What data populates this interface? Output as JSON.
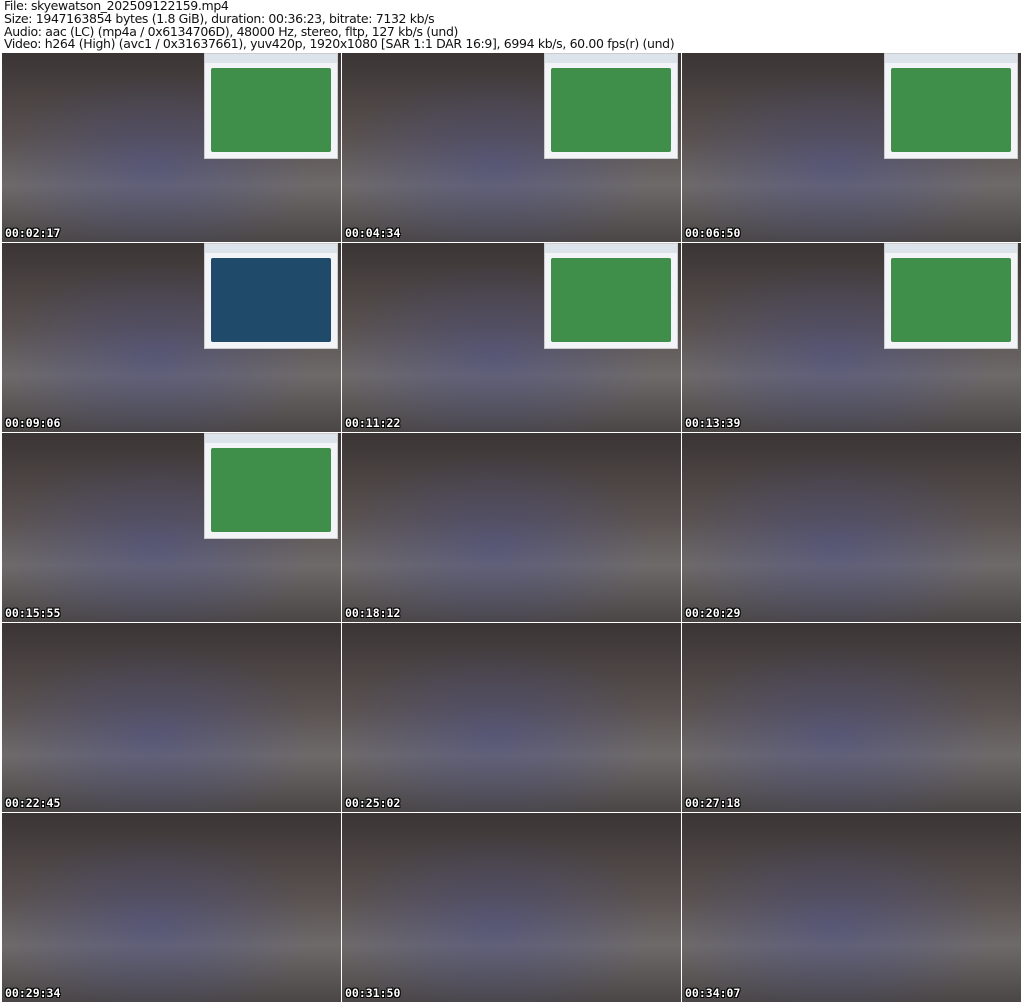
{
  "header": {
    "file": "File: skyewatson_202509122159.mp4",
    "size": "Size: 1947163854 bytes (1.8 GiB), duration: 00:36:23, bitrate: 7132 kb/s",
    "audio": "Audio: aac (LC) (mp4a / 0x6134706D), 48000 Hz, stereo, fltp, 127 kb/s (und)",
    "video": "Video: h264 (High) (avc1 / 0x31637661), yuv420p, 1920x1080 [SAR 1:1 DAR 16:9], 6994 kb/s, 60.00 fps(r) (und)"
  },
  "thumbnails": [
    {
      "time": "00:02:17",
      "overlay": "map"
    },
    {
      "time": "00:04:34",
      "overlay": "map"
    },
    {
      "time": "00:06:50",
      "overlay": "map"
    },
    {
      "time": "00:09:06",
      "overlay": "dark"
    },
    {
      "time": "00:11:22",
      "overlay": "map"
    },
    {
      "time": "00:13:39",
      "overlay": "map"
    },
    {
      "time": "00:15:55",
      "overlay": "map"
    },
    {
      "time": "00:18:12",
      "overlay": ""
    },
    {
      "time": "00:20:29",
      "overlay": ""
    },
    {
      "time": "00:22:45",
      "overlay": ""
    },
    {
      "time": "00:25:02",
      "overlay": ""
    },
    {
      "time": "00:27:18",
      "overlay": ""
    },
    {
      "time": "00:29:34",
      "overlay": ""
    },
    {
      "time": "00:31:50",
      "overlay": ""
    },
    {
      "time": "00:34:07",
      "overlay": ""
    }
  ]
}
